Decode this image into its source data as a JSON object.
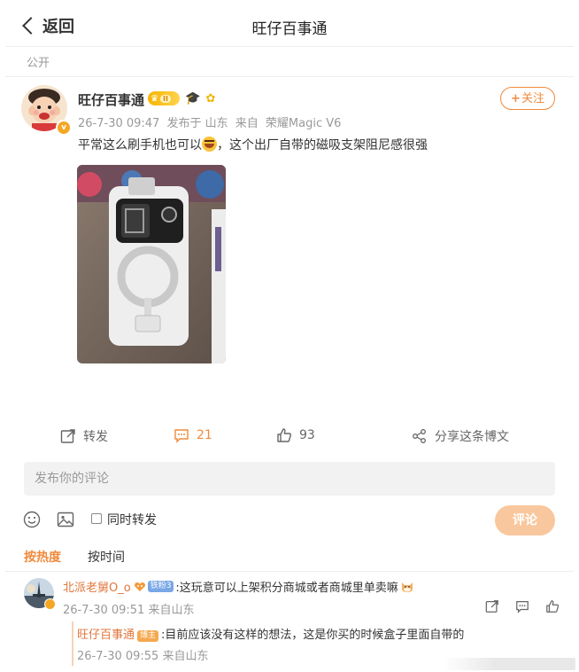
{
  "header": {
    "back_label": "返回",
    "title": "旺仔百事通"
  },
  "visibility": "公开",
  "post": {
    "username": "旺仔百事通",
    "level": "II",
    "date": "26-7-30 09:47",
    "location": "发布于 山东",
    "device_prefix": "来自",
    "device": "荣耀Magic V6",
    "follow_label": "关注",
    "text_before_emoji": "平常这么刷手机也可以",
    "text_after_emoji": "，这个出厂自带的磁吸支架阻尼感很强",
    "icons": [
      "crown-icon",
      "graduation-cap-icon",
      "sunflower-icon"
    ]
  },
  "actions": {
    "repost_label": "转发",
    "comment_count": "21",
    "like_count": "93",
    "share_label": "分享这条博文"
  },
  "comment_box": {
    "placeholder": "发布你的评论",
    "repost_checkbox_label": "同时转发",
    "send_label": "评论"
  },
  "sort": {
    "hot": "按热度",
    "time": "按时间"
  },
  "comments": [
    {
      "user": "北派老舅O_o",
      "level": "铁粉3",
      "text": ":这玩意可以上架积分商城或者商城里单卖嘛",
      "date": "26-7-30 09:51",
      "location": "来自山东",
      "reply": {
        "user": "旺仔百事通",
        "tag": "博主",
        "text": ":目前应该没有这样的想法，这是你买的时候盒子里面自带的",
        "date": "26-7-30 09:55",
        "location": "来自山东"
      }
    }
  ],
  "colors": {
    "accent": "#f08a3c",
    "send_disabled": "#f9c79d"
  }
}
